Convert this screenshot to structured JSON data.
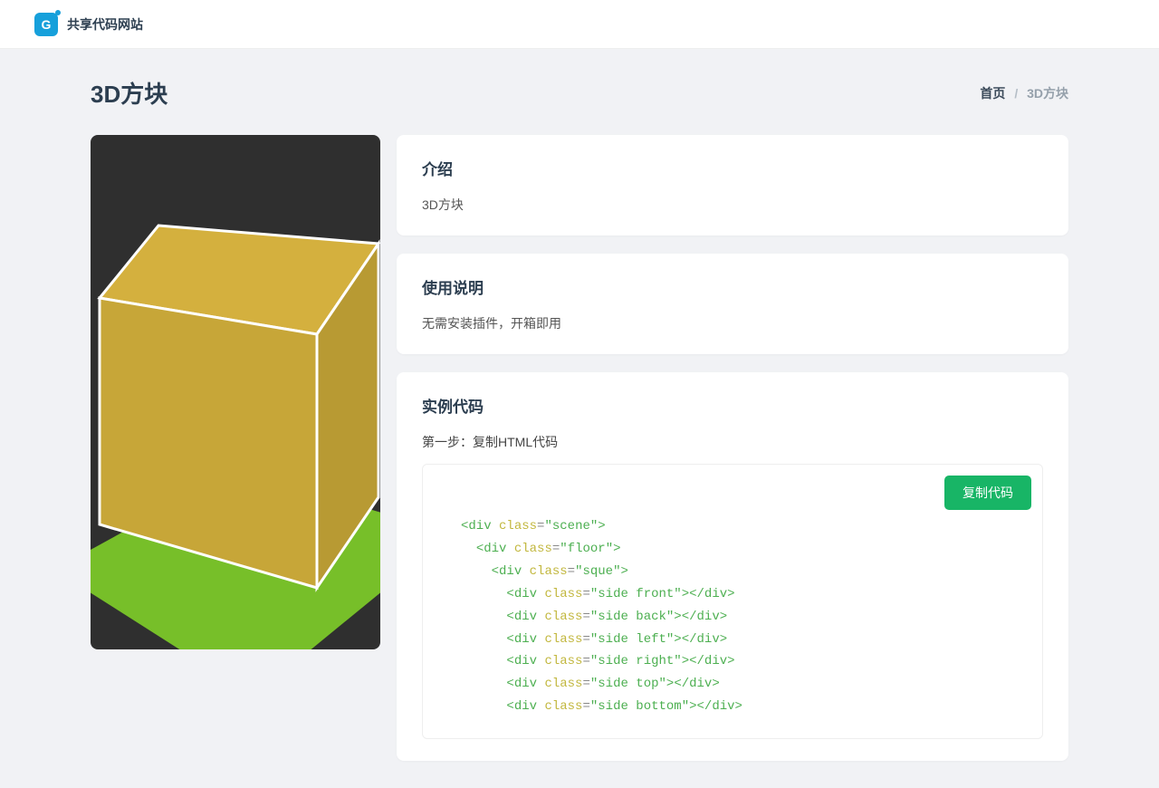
{
  "header": {
    "site_name": "共享代码网站",
    "logo_letter": "G"
  },
  "page": {
    "title": "3D方块"
  },
  "breadcrumb": {
    "home": "首页",
    "current": "3D方块",
    "separator": "/"
  },
  "intro": {
    "heading": "介绍",
    "text": "3D方块"
  },
  "usage": {
    "heading": "使用说明",
    "text": "无需安装插件，开箱即用"
  },
  "example": {
    "heading": "实例代码",
    "step": "第一步：复制HTML代码",
    "copy_label": "复制代码"
  },
  "code_lines": [
    {
      "indent": 0,
      "open": true,
      "tag": "div",
      "attr": "class",
      "val": "scene",
      "close": false
    },
    {
      "indent": 1,
      "open": true,
      "tag": "div",
      "attr": "class",
      "val": "floor",
      "close": false
    },
    {
      "indent": 2,
      "open": true,
      "tag": "div",
      "attr": "class",
      "val": "sque",
      "close": false
    },
    {
      "indent": 3,
      "open": true,
      "tag": "div",
      "attr": "class",
      "val": "side front",
      "close": true
    },
    {
      "indent": 3,
      "open": true,
      "tag": "div",
      "attr": "class",
      "val": "side back",
      "close": true
    },
    {
      "indent": 3,
      "open": true,
      "tag": "div",
      "attr": "class",
      "val": "side left",
      "close": true
    },
    {
      "indent": 3,
      "open": true,
      "tag": "div",
      "attr": "class",
      "val": "side right",
      "close": true
    },
    {
      "indent": 3,
      "open": true,
      "tag": "div",
      "attr": "class",
      "val": "side top",
      "close": true
    },
    {
      "indent": 3,
      "open": true,
      "tag": "div",
      "attr": "class",
      "val": "side bottom",
      "close": true
    }
  ]
}
